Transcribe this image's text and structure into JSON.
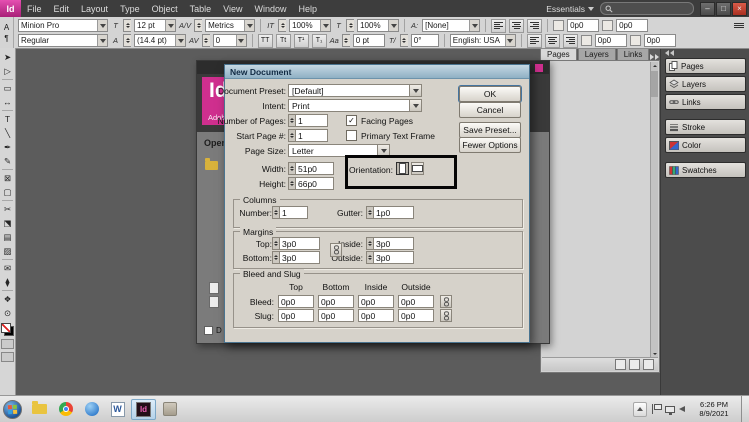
{
  "menubar": {
    "logo": "Id",
    "menus": [
      "File",
      "Edit",
      "Layout",
      "Type",
      "Object",
      "Table",
      "View",
      "Window",
      "Help"
    ],
    "workspace": "Essentials",
    "window_controls": {
      "minimize": "–",
      "maximize": "□",
      "close": "×"
    }
  },
  "controlbar": {
    "side_icons": {
      "char": "A",
      "para": "¶"
    },
    "row1": {
      "font_name": "Minion Pro",
      "size_icon": "T",
      "font_size": "12 pt",
      "kerning_icon": "A/V",
      "kerning": "Metrics",
      "vscale_icon": "IT",
      "vertical_scale": "100%",
      "hscale_icon": "T",
      "horizontal_scale": "100%",
      "style_icon": "A:",
      "character_style": "[None]",
      "pos_fields": [
        "0p0",
        "0p0"
      ]
    },
    "row2": {
      "font_style": "Regular",
      "leading_icon": "A",
      "leading": "(14.4 pt)",
      "tracking_icon": "AV",
      "tracking": "0",
      "format_icons": [
        "TT",
        "Tt",
        "T¹",
        "T₁"
      ],
      "baseline_icon": "Aa",
      "baseline_shift": "0 pt",
      "skew_icon": "T/",
      "skew": "0°",
      "language": "English: USA",
      "indent_fields": [
        "0p0",
        "0p0"
      ]
    }
  },
  "tools": [
    {
      "name": "selection",
      "glyph": "➤"
    },
    {
      "name": "direct-selection",
      "glyph": "▷"
    },
    {
      "name": "page",
      "glyph": "▭"
    },
    {
      "name": "gap",
      "glyph": "↔"
    },
    {
      "name": "type",
      "glyph": "T"
    },
    {
      "name": "line",
      "glyph": "╲"
    },
    {
      "name": "pen",
      "glyph": "✒"
    },
    {
      "name": "pencil",
      "glyph": "✎"
    },
    {
      "name": "frame",
      "glyph": "⊠"
    },
    {
      "name": "rectangle",
      "glyph": "▢"
    },
    {
      "name": "scissors",
      "glyph": "✂"
    },
    {
      "name": "free-transform",
      "glyph": "⬔"
    },
    {
      "name": "gradient",
      "glyph": "▤"
    },
    {
      "name": "gradient-feather",
      "glyph": "▨"
    },
    {
      "name": "note",
      "glyph": "✉"
    },
    {
      "name": "eyedropper",
      "glyph": "⧫"
    },
    {
      "name": "hand",
      "glyph": "❖"
    },
    {
      "name": "zoom",
      "glyph": "⊙"
    }
  ],
  "welcome": {
    "logo": "Id",
    "brand": "Adobe",
    "open_heading": "Open",
    "dont_show_fragment": "D"
  },
  "dialog": {
    "title": "New Document",
    "preset_label": "Document Preset:",
    "preset_value": "[Default]",
    "intent_label": "Intent:",
    "intent_value": "Print",
    "pages_label": "Number of Pages:",
    "pages_value": "1",
    "facing_label": "Facing Pages",
    "start_label": "Start Page #:",
    "start_value": "1",
    "primary_label": "Primary Text Frame",
    "pagesize_label": "Page Size:",
    "pagesize_value": "Letter",
    "width_label": "Width:",
    "width_value": "51p0",
    "height_label": "Height:",
    "height_value": "66p0",
    "orientation_label": "Orientation:",
    "columns": {
      "title": "Columns",
      "number_label": "Number:",
      "number_value": "1",
      "gutter_label": "Gutter:",
      "gutter_value": "1p0"
    },
    "margins": {
      "title": "Margins",
      "top_label": "Top:",
      "top_value": "3p0",
      "bottom_label": "Bottom:",
      "bottom_value": "3p0",
      "inside_label": "Inside:",
      "inside_value": "3p0",
      "outside_label": "Outside:",
      "outside_value": "3p0"
    },
    "bleed_slug": {
      "title": "Bleed and Slug",
      "headers": [
        "Top",
        "Bottom",
        "Inside",
        "Outside"
      ],
      "bleed_label": "Bleed:",
      "bleed": [
        "0p0",
        "0p0",
        "0p0",
        "0p0"
      ],
      "slug_label": "Slug:",
      "slug": [
        "0p0",
        "0p0",
        "0p0",
        "0p0"
      ]
    },
    "buttons": {
      "ok": "OK",
      "cancel": "Cancel",
      "save_preset": "Save Preset...",
      "fewer_options": "Fewer Options"
    }
  },
  "panels": {
    "tabs": [
      "Pages",
      "Layers",
      "Links"
    ],
    "dock_buttons": [
      "Pages",
      "Layers",
      "Links",
      "Stroke",
      "Color",
      "Swatches"
    ]
  },
  "taskbar": {
    "word_label": "W",
    "indesign_label": "Id",
    "time": "6:26 PM",
    "date": "8/9/2021"
  },
  "glyphs": {
    "check": "✓"
  }
}
